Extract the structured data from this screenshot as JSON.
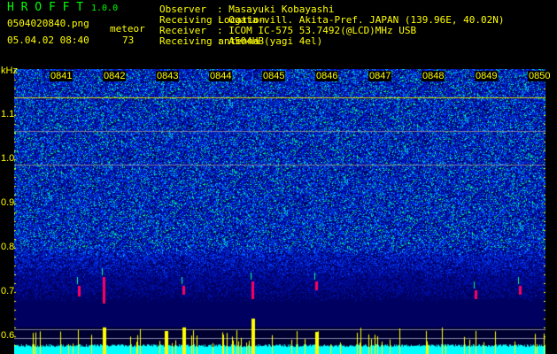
{
  "header": {
    "app_name": "H R O F F T",
    "version": "1.0.0",
    "filename": "0504020840.png",
    "datetime": "05.04.02 08:40",
    "meteor_label": "meteor",
    "meteor_count": "73",
    "info": [
      {
        "label": "Observer",
        "value": ": Masayuki Kobayashi"
      },
      {
        "label": "Receiving Location",
        "value": ": Ogata-vill. Akita-Pref. JAPAN (139.96E, 40.02N)"
      },
      {
        "label": "Receiver",
        "value": ": ICOM IC-575 53.7492(@LCD)MHz USB"
      },
      {
        "label": "Receiving antenna",
        "value": ": A504HB(yagi 4el)"
      }
    ]
  },
  "colors": {
    "text": "#ffff00",
    "logo": "#00ff00",
    "noise_low": "#000080",
    "noise_mid": "#0040ff",
    "peak": "#ff0060",
    "level": "#00ffff"
  },
  "chart_data": {
    "type": "heatmap",
    "ylabel": "kHz",
    "yticks": [
      "1.1",
      "1.0",
      "0.9",
      "0.8",
      "0.7",
      "0.6"
    ],
    "xticks": [
      "0841",
      "0842",
      "0843",
      "0844",
      "0845",
      "0846",
      "0847",
      "0848",
      "0849",
      "0850"
    ],
    "ylim": [
      0.56,
      1.2
    ]
  }
}
